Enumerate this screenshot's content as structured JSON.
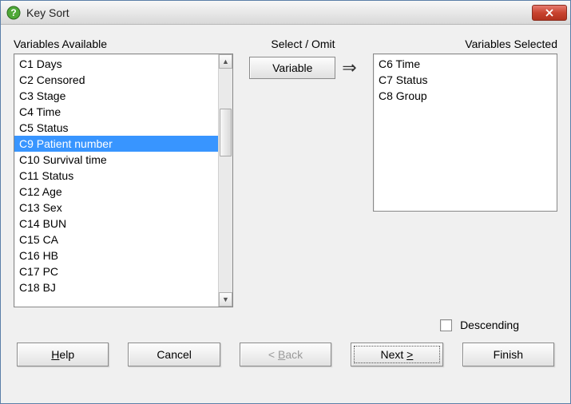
{
  "window": {
    "title": "Key Sort"
  },
  "labels": {
    "available": "Variables Available",
    "selectOmit": "Select / Omit",
    "selected": "Variables Selected",
    "variableButton": "Variable",
    "descending": "Descending"
  },
  "available": [
    "C1 Days",
    "C2 Censored",
    "C3 Stage",
    "C4 Time",
    "C5 Status",
    "C9 Patient number",
    "C10 Survival time",
    "C11 Status",
    "C12 Age",
    "C13 Sex",
    "C14 BUN",
    "C15 CA",
    "C16 HB",
    "C17 PC",
    "C18 BJ"
  ],
  "availableSelectedIndex": 5,
  "selected": [
    "C6 Time",
    "C7 Status",
    "C8 Group"
  ],
  "descending": false,
  "buttons": {
    "help": "Help",
    "cancel": "Cancel",
    "back": "< Back",
    "next": "Next >",
    "finish": "Finish"
  }
}
